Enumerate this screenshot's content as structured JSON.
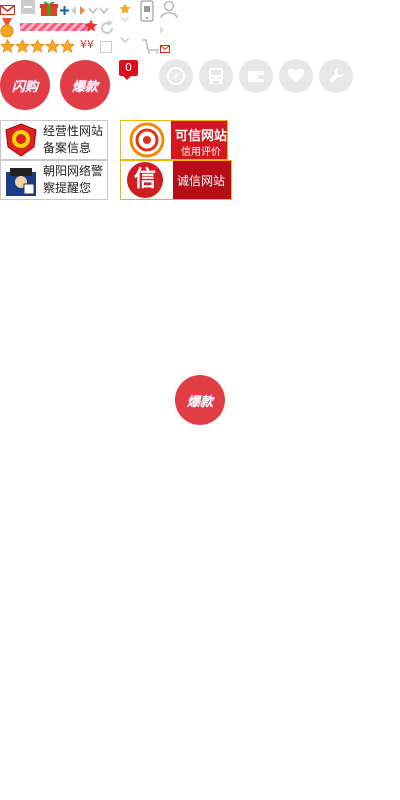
{
  "sprite_row": {
    "rmb_symbols": "¥¥",
    "message_count": "0"
  },
  "badges": {
    "flash_sale": "闪购",
    "hot_item": "爆款",
    "hot_item_floating": "爆款"
  },
  "certificates": {
    "business_site_line1": "经营性网站",
    "business_site_line2": "备案信息",
    "police_line1": "朝阳网络警",
    "police_line2": "察提醒您",
    "credible_title": "可信网站",
    "credible_subtitle": "信用评价",
    "honest_title": "诚信网站",
    "honest_glyph": "信"
  },
  "icons": [
    "mail-icon",
    "minus-icon",
    "gift-icon",
    "plus-icon",
    "arrow-left-icon",
    "arrow-right-icon",
    "chevron-down-icon",
    "star-icon",
    "phone-qr-icon",
    "user-icon",
    "medal-icon",
    "refresh-icon",
    "checkbox-icon",
    "cart-icon",
    "compass-icon",
    "bus-icon",
    "wallet-icon",
    "heart-icon",
    "wrench-icon"
  ],
  "colors": {
    "badge_red": "#e23d44",
    "star_gold": "#f6a623",
    "count_red": "#d8121c",
    "icon_gray": "#e8e8e8"
  },
  "rating": {
    "stars": 5,
    "max": 5
  }
}
